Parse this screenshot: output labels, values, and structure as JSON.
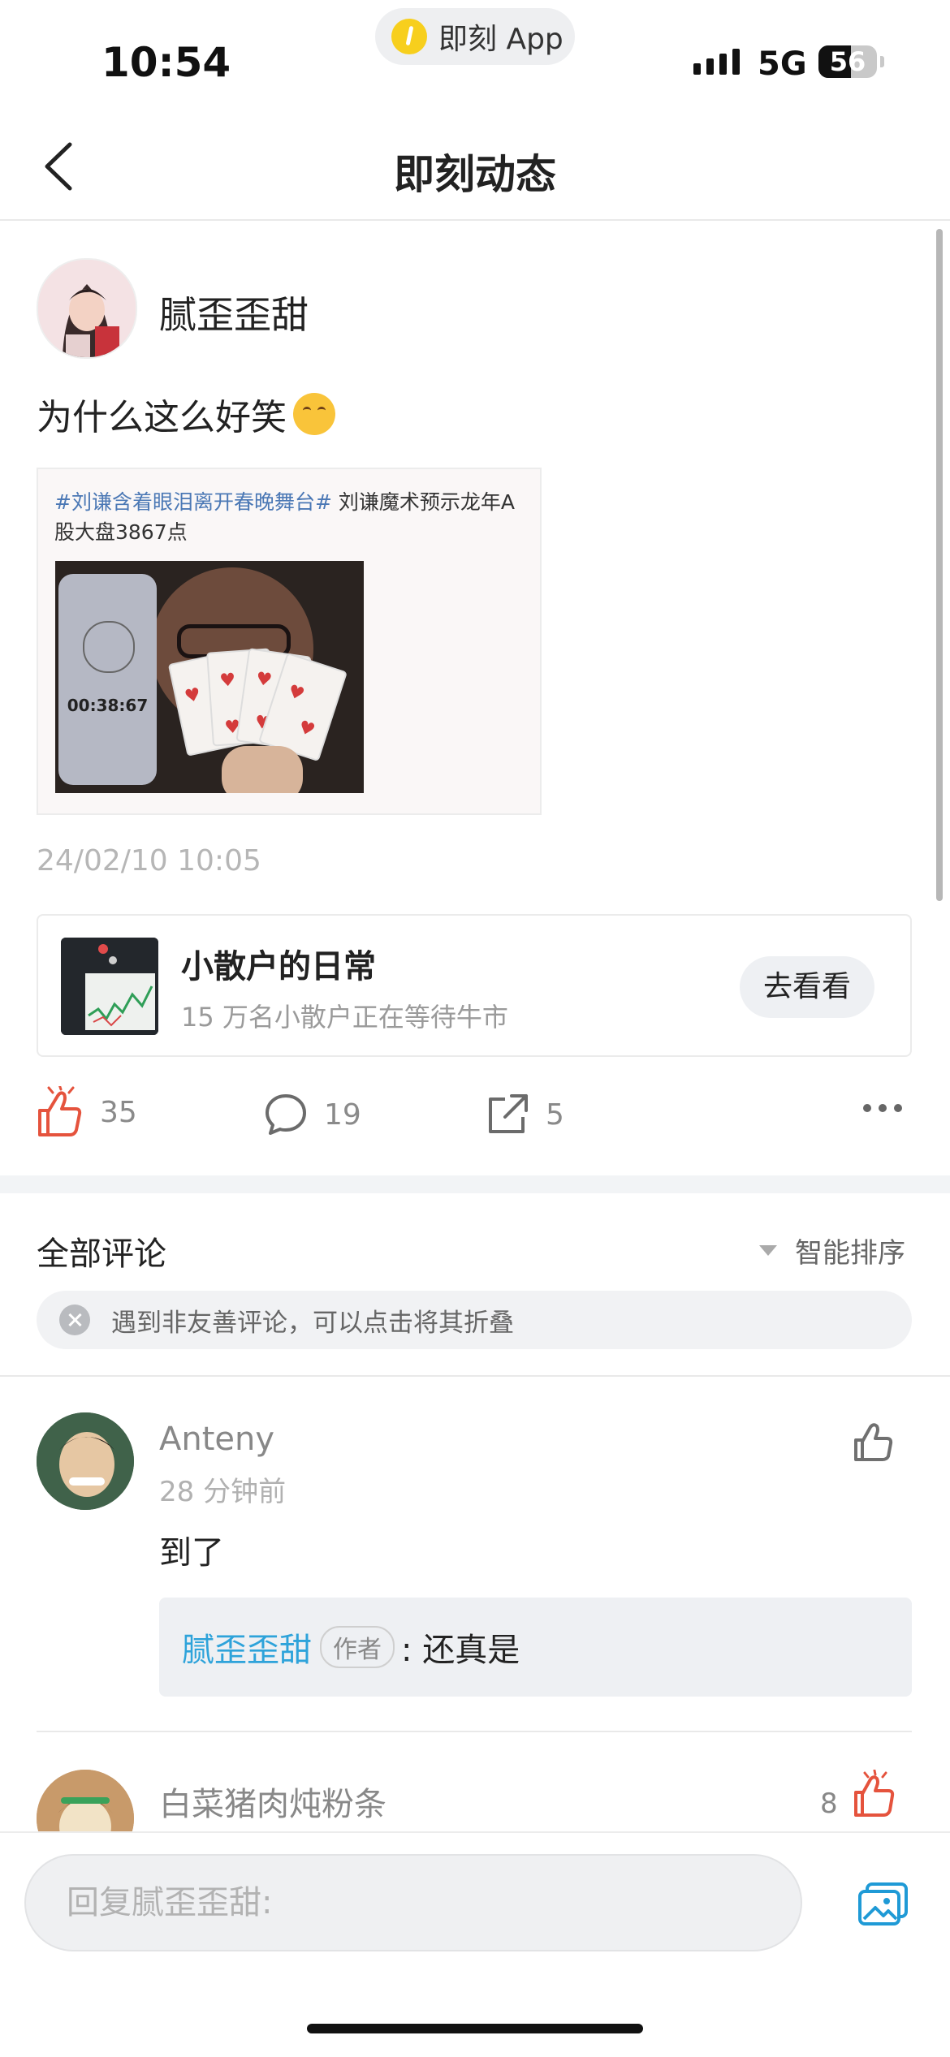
{
  "status_bar": {
    "time": "10:54",
    "app_pill_label": "即刻 App",
    "network": "5G",
    "battery": "56",
    "battery_level_percent": 56
  },
  "nav": {
    "title": "即刻动态"
  },
  "post": {
    "author": "腻歪歪甜",
    "text": "为什么这么好笑",
    "image": {
      "tag_text": "#刘谦含着眼泪离开春晚舞台#",
      "headline": " 刘谦魔术预示龙年A股大盘3867点",
      "phone_time": "00:38:67"
    },
    "timestamp": "24/02/10 10:05",
    "topic": {
      "title": "小散户的日常",
      "subtitle": "15 万名小散户正在等待牛市",
      "button": "去看看"
    },
    "actions": {
      "likes": "35",
      "comments": "19",
      "shares": "5"
    }
  },
  "comments_section": {
    "title": "全部评论",
    "sort_label": "智能排序",
    "notice": "遇到非友善评论，可以点击将其折叠",
    "comments": [
      {
        "name": "Anteny",
        "time": "28 分钟前",
        "text": "到了",
        "reply": {
          "name": "腻歪歪甜",
          "badge": "作者",
          "text": ": 还真是"
        }
      },
      {
        "name": "白菜猪肉炖粉条",
        "likes": "8"
      }
    ]
  },
  "reply_bar": {
    "placeholder": "回复腻歪歪甜:"
  },
  "colors": {
    "accent_like": "#e5533d",
    "link_blue": "#2ea3da",
    "brand_yellow": "#f7cf1d"
  },
  "icons": [
    "back-icon",
    "like-icon",
    "comment-icon",
    "share-icon",
    "more-icon",
    "sort-triangle-icon",
    "close-circle-icon",
    "image-upload-icon"
  ]
}
